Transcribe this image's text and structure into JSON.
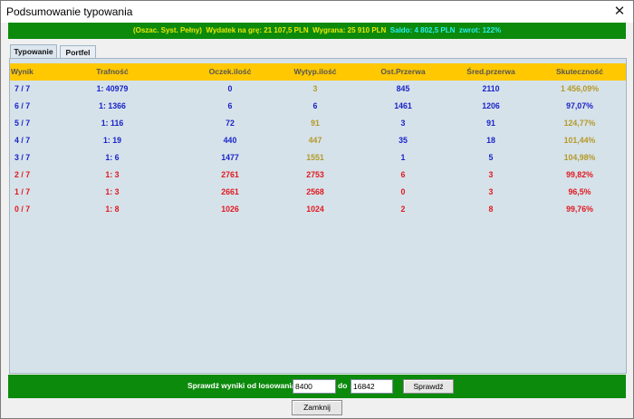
{
  "window": {
    "title": "Podsumowanie typowania",
    "close_glyph": "✕"
  },
  "summary": {
    "system": "(Oszac. Syst. Pełny)",
    "wydatek": "Wydatek na grę: 21 107,5 PLN",
    "wygrana": "Wygrana: 25 910 PLN",
    "saldo": "Saldo: 4 802,5 PLN",
    "zwrot": "zwrot: 122%"
  },
  "tabs": [
    "Typowanie",
    "Portfel"
  ],
  "table": {
    "headers": [
      "Wynik",
      "Trafność",
      "Oczek.ilość",
      "Wytyp.ilość",
      "Ost.Przerwa",
      "Śred.przerwa",
      "Skuteczność"
    ],
    "rows": [
      {
        "cells": [
          "7 / 7",
          "1: 40979",
          "0",
          "3",
          "845",
          "2110",
          "1 456,09%"
        ],
        "color": "#1a24c8",
        "wytyp_color": "#b39a2a",
        "skut_color": "#b39a2a"
      },
      {
        "cells": [
          "6 / 7",
          "1: 1366",
          "6",
          "6",
          "1461",
          "1206",
          "97,07%"
        ],
        "color": "#1a24c8",
        "wytyp_color": "#1a24c8",
        "skut_color": "#1a24c8"
      },
      {
        "cells": [
          "5 / 7",
          "1: 116",
          "72",
          "91",
          "3",
          "91",
          "124,77%"
        ],
        "color": "#1a24c8",
        "wytyp_color": "#b39a2a",
        "skut_color": "#b39a2a"
      },
      {
        "cells": [
          "4 / 7",
          "1: 19",
          "440",
          "447",
          "35",
          "18",
          "101,44%"
        ],
        "color": "#1a24c8",
        "wytyp_color": "#b39a2a",
        "skut_color": "#b39a2a"
      },
      {
        "cells": [
          "3 / 7",
          "1: 6",
          "1477",
          "1551",
          "1",
          "5",
          "104,98%"
        ],
        "color": "#1a24c8",
        "wytyp_color": "#b39a2a",
        "skut_color": "#b39a2a"
      },
      {
        "cells": [
          "2 / 7",
          "1: 3",
          "2761",
          "2753",
          "6",
          "3",
          "99,82%"
        ],
        "color": "#e0191f",
        "wytyp_color": "#e0191f",
        "skut_color": "#e0191f"
      },
      {
        "cells": [
          "1 / 7",
          "1: 3",
          "2661",
          "2568",
          "0",
          "3",
          "96,5%"
        ],
        "color": "#e0191f",
        "wytyp_color": "#e0191f",
        "skut_color": "#e0191f"
      },
      {
        "cells": [
          "0 / 7",
          "1: 8",
          "1026",
          "1024",
          "2",
          "8",
          "99,76%"
        ],
        "color": "#e0191f",
        "wytyp_color": "#e0191f",
        "skut_color": "#e0191f"
      }
    ]
  },
  "check": {
    "label": "Sprawdź wyniki od losowania:",
    "from_value": "8400",
    "to_label": "do",
    "to_value": "16842",
    "button_label": "Sprawdź"
  },
  "close_button_label": "Zamknij",
  "colors": {
    "green_bar": "#0c8a0c",
    "header_yellow": "#ffc800",
    "panel_bg": "#d6e2ea"
  }
}
